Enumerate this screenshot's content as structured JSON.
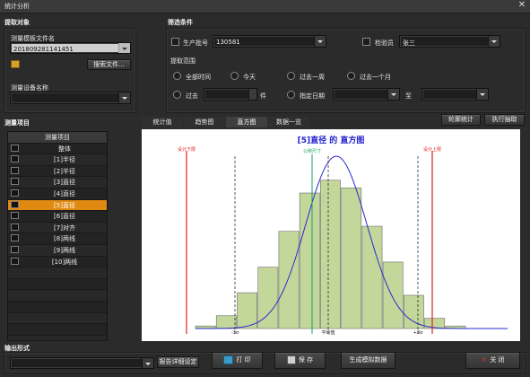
{
  "window": {
    "title": "统计分析",
    "close_glyph": "✕"
  },
  "extract": {
    "section": "提取对象",
    "template_label": "测量模板文件名",
    "template_value": "201809281141451",
    "browse_button": "搜索文件...",
    "device_label": "测量设备名称",
    "device_value": ""
  },
  "filter": {
    "section": "筛选条件",
    "batch_label": "生产批号",
    "batch_value": "130581",
    "inspector_label": "检验员",
    "inspector_value": "张三",
    "range_label": "提取范围",
    "all_time": "全部时间",
    "today": "今天",
    "past_week": "过去一周",
    "past_month": "过去一个月",
    "past": "过去",
    "past_count": "",
    "unit": "件",
    "date_label": "指定日期",
    "to": "至"
  },
  "measure": {
    "section": "测量项目",
    "header": "测量项目",
    "items": [
      "整体",
      "[1]半径",
      "[2]半径",
      "[3]直径",
      "[4]直径",
      "[5]直径",
      "[6]直径",
      "[7]对齐",
      "[8]两线",
      "[9]两线",
      "[10]两线"
    ],
    "selected_index": 5
  },
  "tabs": [
    "统计值",
    "趋势图",
    "直方图",
    "数据一览"
  ],
  "active_tab": 2,
  "actions": {
    "tune": "轮廓统计",
    "execute": "执行抽取"
  },
  "output": {
    "section": "输出形式",
    "format_value": "",
    "detail_button": "报告详细设定",
    "print": "打 印",
    "save": "保 存",
    "simulate": "生成模拟数据",
    "close": "关 闭"
  },
  "colors": {
    "accent": "#e08a12",
    "bar_fill": "#c4d79b",
    "curve": "#2a2ad0",
    "title": "#1c1cd0",
    "limit": "#e02020",
    "nominal": "#18a060"
  },
  "chart_data": {
    "type": "bar",
    "title": "[5]直径 的 直方图",
    "values": [
      1,
      5,
      14,
      24,
      38,
      53,
      58,
      55,
      40,
      26,
      13,
      4,
      1
    ],
    "ylim": [
      0,
      66
    ],
    "curve": "normal",
    "labels": {
      "lower_limit": "设计下限",
      "upper_limit": "设计上限",
      "nominal": "公称尺寸",
      "minus3s": "-3σ",
      "mean": "平均值",
      "plus3s": "+3σ"
    }
  }
}
